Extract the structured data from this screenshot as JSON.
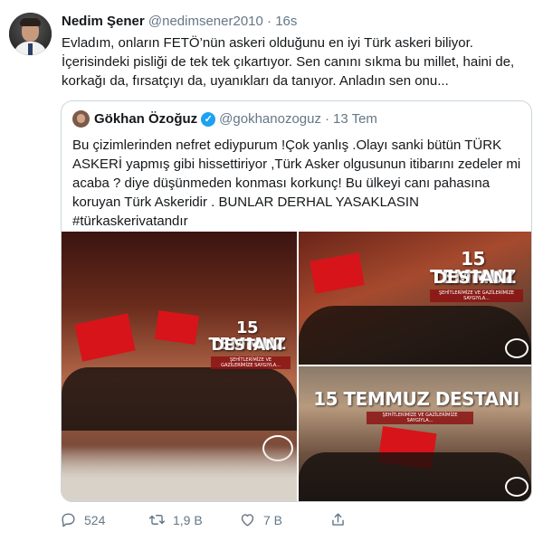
{
  "tweet": {
    "author_name": "Nedim Şener",
    "author_handle": "@nedimsener2010",
    "separator": "·",
    "time": "16s",
    "text": "Evladım, onların FETÖ’nün askeri olduğunu en iyi Türk askeri biliyor. İçerisindeki pisliği de tek tek çıkartıyor. Sen canını sıkma bu millet, haini de, korkağı da, fırsatçıyı da, uyanıkları da tanıyor. Anladın sen onu..."
  },
  "quoted": {
    "author_name": "Gökhan Özoğuz",
    "author_handle": "@gokhanozoguz",
    "separator": "·",
    "time": "13 Tem",
    "text": "Bu çizimlerinden nefret ediypurum !Çok yanlış .Olayı sanki bütün TÜRK ASKERİ yapmış gibi hissettiriyor ,Türk Asker olgusunun itibarını zedeler mi acaba ? diye düşünmeden konması korkunç! Bu ülkeyi canı pahasına koruyan Türk Askeridir . BUNLAR DERHAL YASAKLASIN #türkaskerivatandır",
    "images": [
      {
        "title_line1": "15 TEMMUZ",
        "title_line2": "DESTANI",
        "subtitle": "ŞEHİTLERİMİZE VE GAZİLERİMİZE SAYGIYLA..."
      },
      {
        "title_line1": "15 TEMMUZ",
        "title_line2": "DESTANI",
        "subtitle": "ŞEHİTLERİMİZE VE GAZİLERİMİZE SAYGIYLA..."
      },
      {
        "title_line1": "15 TEMMUZ DESTANI",
        "title_line2": "",
        "subtitle": "ŞEHİTLERİMİZE VE GAZİLERİMİZE SAYGIYLA..."
      }
    ]
  },
  "actions": {
    "reply_count": "524",
    "retweet_count": "1,9 B",
    "like_count": "7 B"
  },
  "icons": {
    "reply": "reply-icon",
    "retweet": "retweet-icon",
    "like": "heart-icon",
    "share": "share-icon",
    "verified": "verified-badge-icon"
  },
  "colors": {
    "secondary_text": "#657786",
    "border": "#ccd6dd",
    "verified": "#1da1f2"
  }
}
